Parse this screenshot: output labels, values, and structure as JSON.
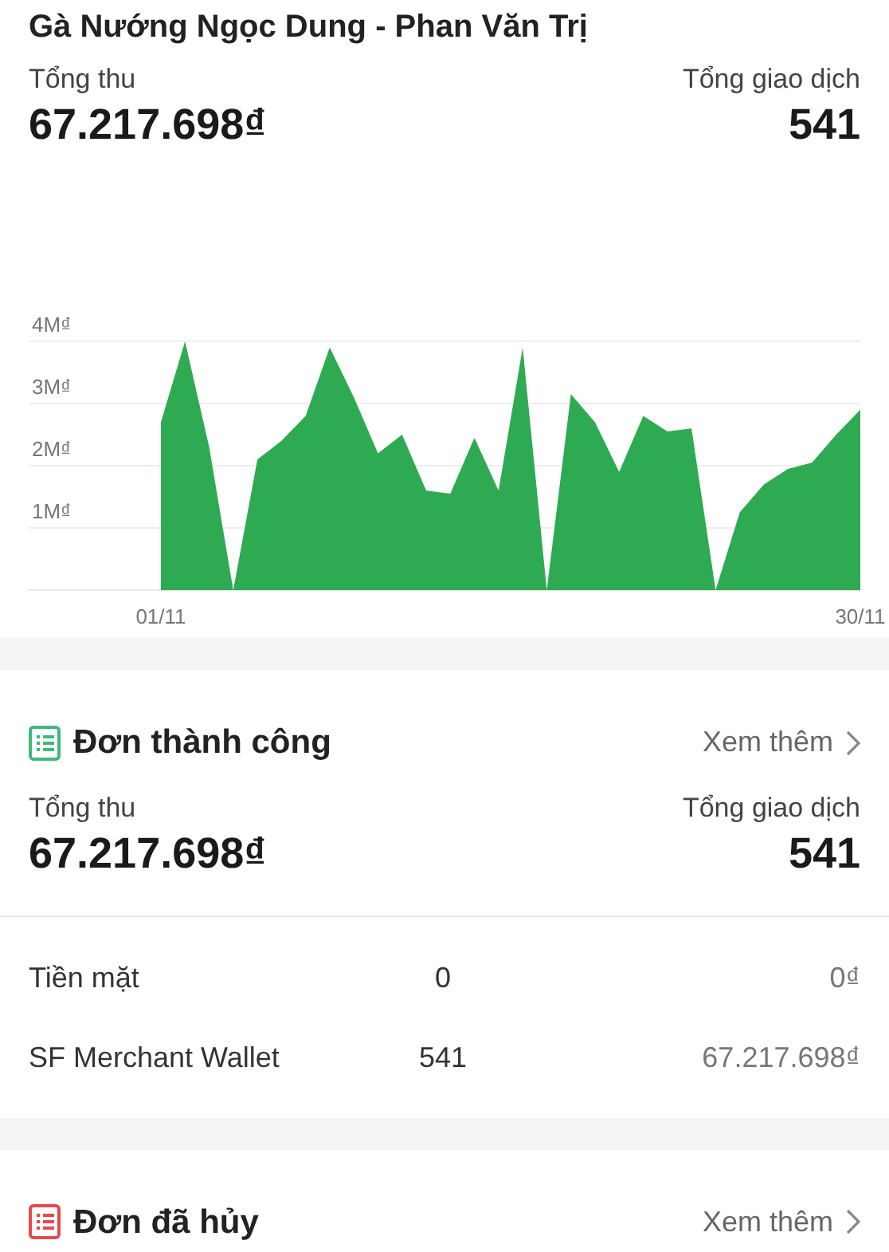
{
  "header": {
    "title": "Gà Nướng Ngọc Dung - Phan Văn Trị"
  },
  "summary": {
    "revenue_label": "Tổng thu",
    "revenue": "67.217.698₫",
    "count_label": "Tổng giao dịch",
    "count": "541",
    "chart_data": {
      "type": "area",
      "categories": [
        "01/11",
        null,
        null,
        null,
        null,
        null,
        null,
        null,
        null,
        null,
        null,
        null,
        null,
        null,
        null,
        null,
        null,
        null,
        null,
        null,
        null,
        null,
        null,
        null,
        null,
        null,
        null,
        null,
        null,
        "30/11"
      ],
      "series": [
        {
          "color": "#2eab52",
          "values": [
            2700000,
            4000000,
            2300000,
            0,
            2100000,
            2400000,
            2800000,
            3900000,
            3100000,
            2200000,
            2500000,
            1600000,
            1550000,
            2450000,
            1600000,
            3900000,
            0,
            3150000,
            2700000,
            1900000,
            2800000,
            2550000,
            2600000,
            0,
            1250000,
            1700000,
            1950000,
            2050000,
            2500000,
            2900000
          ]
        }
      ],
      "ylim": [
        0,
        4000000
      ],
      "grid": true,
      "yticks": [
        {
          "value": 1000000,
          "label": "1M₫"
        },
        {
          "value": 2000000,
          "label": "2M₫"
        },
        {
          "value": 3000000,
          "label": "3M₫"
        },
        {
          "value": 4000000,
          "label": "4M₫"
        }
      ]
    }
  },
  "sections": [
    {
      "kind": "success",
      "title": "Đơn thành công",
      "more": "Xem thêm",
      "summary": {
        "revenue_label": "Tổng thu",
        "revenue": "67.217.698₫",
        "count_label": "Tổng giao dịch",
        "count": "541"
      },
      "payments": [
        {
          "method": "Tiền mặt",
          "count": "0",
          "amount": "0₫"
        },
        {
          "method": "SF Merchant Wallet",
          "count": "541",
          "amount": "67.217.698₫"
        }
      ]
    },
    {
      "kind": "cancelled",
      "title": "Đơn đã hủy",
      "more": "Xem thêm"
    }
  ]
}
